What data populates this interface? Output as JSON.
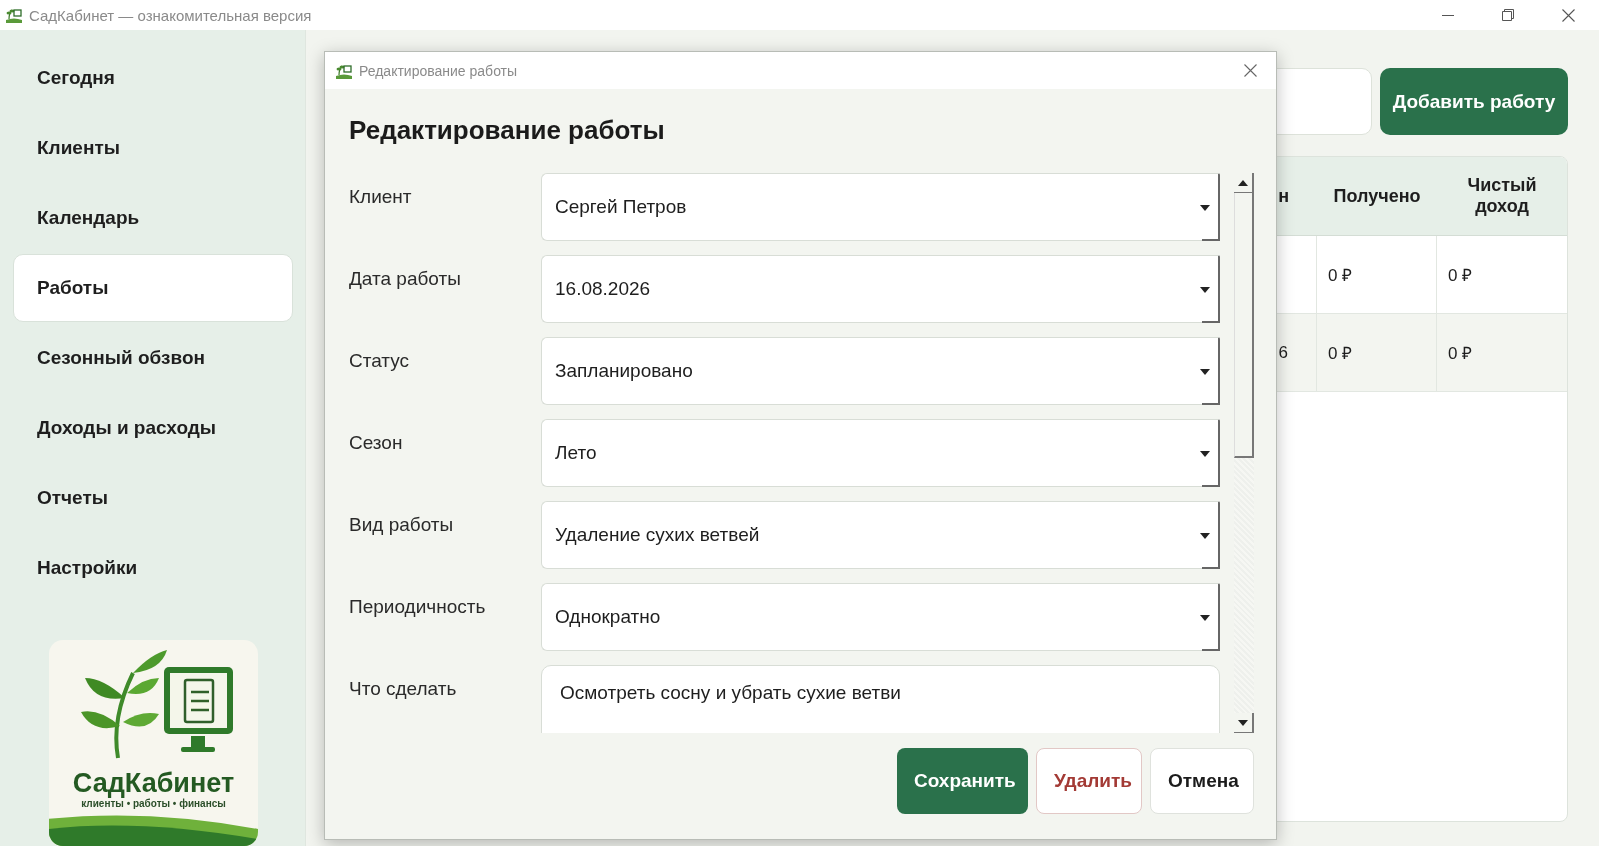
{
  "window": {
    "title": "СадКабинет — ознакомительная версия"
  },
  "sidebar": {
    "items": [
      {
        "label": "Сегодня",
        "selected": false
      },
      {
        "label": "Клиенты",
        "selected": false
      },
      {
        "label": "Календарь",
        "selected": false
      },
      {
        "label": "Работы",
        "selected": true
      },
      {
        "label": "Сезонный обзвон",
        "selected": false
      },
      {
        "label": "Доходы и расходы",
        "selected": false
      },
      {
        "label": "Отчеты",
        "selected": false
      },
      {
        "label": "Настройки",
        "selected": false
      }
    ],
    "logo": {
      "title": "СадКабинет",
      "tagline": "клиенты • работы • финансы"
    }
  },
  "toolbar": {
    "add_button": "Добавить работу"
  },
  "table": {
    "header": {
      "cut_column": "н",
      "columns": [
        "Получено",
        "Чистый доход"
      ]
    },
    "rows": [
      {
        "cells": [
          "0 ₽",
          "0 ₽"
        ]
      },
      {
        "cut_cell": "6",
        "cells": [
          "0 ₽",
          "0 ₽"
        ]
      }
    ]
  },
  "dialog": {
    "title": "Редактирование работы",
    "heading": "Редактирование работы",
    "fields": [
      {
        "label": "Клиент",
        "kind": "select",
        "value": "Сергей Петров"
      },
      {
        "label": "Дата работы",
        "kind": "select",
        "value": "16.08.2026"
      },
      {
        "label": "Статус",
        "kind": "select",
        "value": "Запланировано"
      },
      {
        "label": "Сезон",
        "kind": "select",
        "value": "Лето"
      },
      {
        "label": "Вид работы",
        "kind": "select",
        "value": "Удаление сухих ветвей"
      },
      {
        "label": "Периодичность",
        "kind": "select",
        "value": "Однократно"
      },
      {
        "label": "Что сделать",
        "kind": "text",
        "value": "Осмотреть сосну и убрать сухие ветви"
      }
    ],
    "buttons": [
      {
        "label": "Сохранить",
        "kind": "primary"
      },
      {
        "label": "Удалить",
        "kind": "danger"
      },
      {
        "label": "Отмена",
        "kind": "plain"
      }
    ]
  }
}
